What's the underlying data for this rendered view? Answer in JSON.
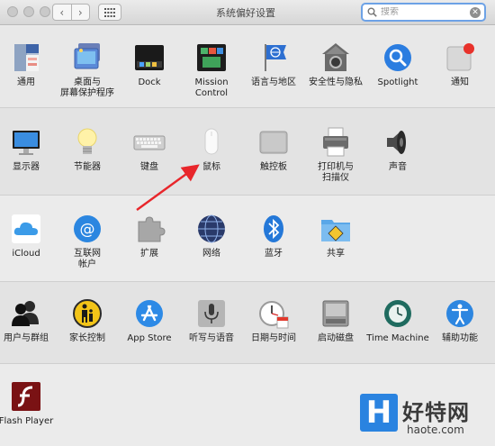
{
  "window": {
    "title": "系统偏好设置",
    "search_placeholder": "搜索",
    "back_glyph": "‹",
    "forward_glyph": "›",
    "clear_glyph": "✕"
  },
  "sections": [
    {
      "items": [
        {
          "label": "通用",
          "icon": "general-icon"
        },
        {
          "label": "桌面与\n屏幕保护程序",
          "icon": "desktop-screensaver-icon"
        },
        {
          "label": "Dock",
          "icon": "dock-icon"
        },
        {
          "label": "Mission\nControl",
          "icon": "mission-control-icon"
        },
        {
          "label": "语言与地区",
          "icon": "language-region-icon"
        },
        {
          "label": "安全性与隐私",
          "icon": "security-privacy-icon"
        },
        {
          "label": "Spotlight",
          "icon": "spotlight-icon"
        },
        {
          "label": "通知",
          "icon": "notifications-icon"
        }
      ]
    },
    {
      "items": [
        {
          "label": "显示器",
          "icon": "displays-icon"
        },
        {
          "label": "节能器",
          "icon": "energy-saver-icon"
        },
        {
          "label": "键盘",
          "icon": "keyboard-icon"
        },
        {
          "label": "鼠标",
          "icon": "mouse-icon"
        },
        {
          "label": "触控板",
          "icon": "trackpad-icon"
        },
        {
          "label": "打印机与\n扫描仪",
          "icon": "printers-scanners-icon"
        },
        {
          "label": "声音",
          "icon": "sound-icon"
        }
      ]
    },
    {
      "items": [
        {
          "label": "iCloud",
          "icon": "icloud-icon"
        },
        {
          "label": "互联网\n帐户",
          "icon": "internet-accounts-icon"
        },
        {
          "label": "扩展",
          "icon": "extensions-icon"
        },
        {
          "label": "网络",
          "icon": "network-icon"
        },
        {
          "label": "蓝牙",
          "icon": "bluetooth-icon"
        },
        {
          "label": "共享",
          "icon": "sharing-icon"
        }
      ]
    },
    {
      "items": [
        {
          "label": "用户与群组",
          "icon": "users-groups-icon"
        },
        {
          "label": "家长控制",
          "icon": "parental-controls-icon"
        },
        {
          "label": "App Store",
          "icon": "app-store-icon"
        },
        {
          "label": "听写与语音",
          "icon": "dictation-speech-icon"
        },
        {
          "label": "日期与时间",
          "icon": "date-time-icon"
        },
        {
          "label": "启动磁盘",
          "icon": "startup-disk-icon"
        },
        {
          "label": "Time Machine",
          "icon": "time-machine-icon"
        },
        {
          "label": "辅助功能",
          "icon": "accessibility-icon"
        }
      ]
    },
    {
      "items": [
        {
          "label": "Flash Player",
          "icon": "flash-player-icon"
        }
      ]
    }
  ],
  "watermark": {
    "logo_letter": "H",
    "text": "好特网",
    "url": "haote.com"
  },
  "colors": {
    "accent": "#1a7be0",
    "arrow": "#e8262b",
    "search_focus": "#6da2e6"
  }
}
